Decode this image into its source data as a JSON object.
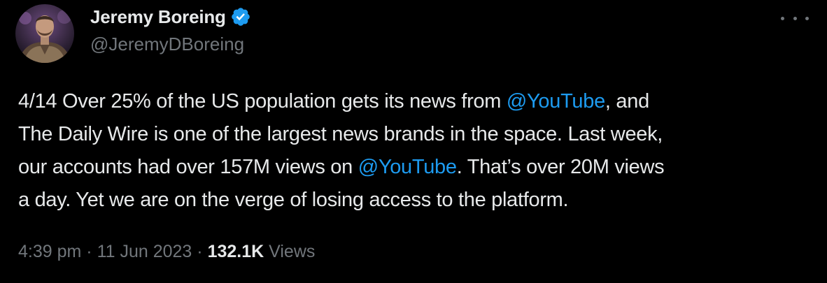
{
  "author": {
    "display_name": "Jeremy Boreing",
    "handle": "@JeremyDBoreing",
    "verified_icon": "verified-badge-icon",
    "avatar_alt": "Jeremy Boreing avatar"
  },
  "tweet": {
    "line1_pre": "4/14 Over 25% of the US population gets its news from ",
    "mention1": "@YouTube",
    "line1_post": ", and",
    "line2": "The Daily Wire is one of the largest news brands in the space. Last week,",
    "line3_pre": "our accounts had over 157M views on ",
    "mention2": "@YouTube",
    "line3_post": ". That’s over 20M views",
    "line4": "a day. Yet we are on the verge of losing access to the platform."
  },
  "meta": {
    "time": "4:39 pm",
    "sep1": " · ",
    "date": "11 Jun 2023",
    "sep2": " · ",
    "views_count": "132.1K",
    "views_label": " Views"
  },
  "icons": {
    "more": "more-options-icon"
  },
  "colors": {
    "background": "#000000",
    "text": "#e7e9ea",
    "secondary": "#71767b",
    "link": "#1d9bf0",
    "verified": "#1d9bf0"
  }
}
